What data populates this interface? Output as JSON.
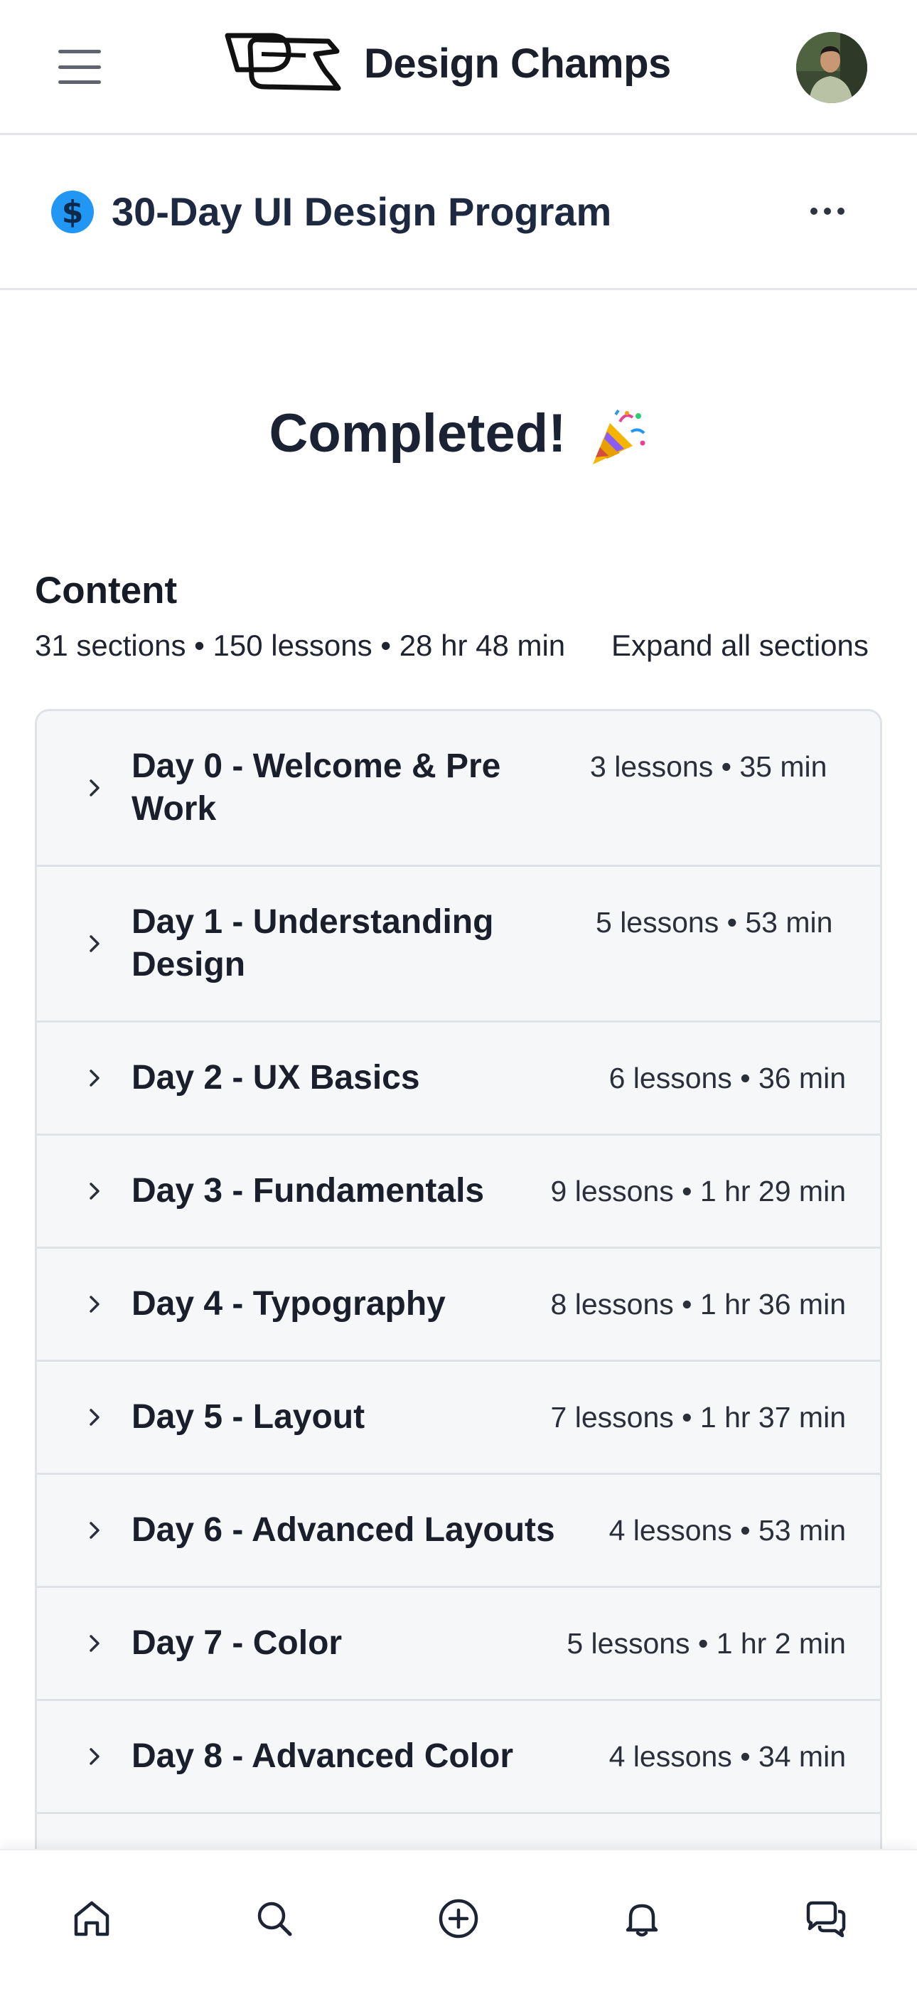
{
  "header": {
    "brand_name": "Design Champs",
    "logo_icon": "design-champs-logo",
    "menu_icon": "hamburger-menu-icon",
    "avatar_icon": "user-avatar"
  },
  "course": {
    "icon": "dollar-circle-icon",
    "icon_glyph": "$",
    "title": "30-Day UI Design Program",
    "more_icon": "more-horizontal-icon"
  },
  "status": {
    "text": "Completed!",
    "emoji_icon": "party-popper-icon"
  },
  "content": {
    "heading": "Content",
    "meta": "31 sections • 150 lessons • 28 hr 48 min",
    "expand_label": "Expand all sections",
    "sections": [
      {
        "title": "Day 0 - Welcome & Pre Work",
        "meta": "3 lessons • 35 min"
      },
      {
        "title": "Day 1 - Understanding Design",
        "meta": "5 lessons • 53 min"
      },
      {
        "title": "Day 2 - UX Basics",
        "meta": "6 lessons • 36 min"
      },
      {
        "title": "Day 3 - Fundamentals",
        "meta": "9 lessons • 1 hr 29 min"
      },
      {
        "title": "Day 4 - Typography",
        "meta": "8 lessons • 1 hr 36 min"
      },
      {
        "title": "Day 5 - Layout",
        "meta": "7 lessons • 1 hr 37 min"
      },
      {
        "title": "Day 6 - Advanced Layouts",
        "meta": "4 lessons • 53 min"
      },
      {
        "title": "Day 7 - Color",
        "meta": "5 lessons • 1 hr 2 min"
      },
      {
        "title": "Day 8 - Advanced Color",
        "meta": "4 lessons • 34 min"
      }
    ]
  },
  "bottom_nav": {
    "items": [
      {
        "icon": "home-icon"
      },
      {
        "icon": "search-icon"
      },
      {
        "icon": "add-circle-icon"
      },
      {
        "icon": "bell-icon"
      },
      {
        "icon": "chat-icon"
      }
    ]
  },
  "colors": {
    "accent_blue": "#2196f3",
    "text_dark": "#1a1f2b",
    "row_bg": "#f6f7f9",
    "border": "#dfe2e6"
  }
}
